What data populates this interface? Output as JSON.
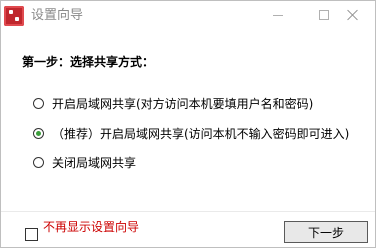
{
  "window": {
    "title": "设置向导",
    "icon": "app-logo-icon"
  },
  "main": {
    "heading": "第一步：选择共享方式：",
    "options": [
      {
        "label": "开启局域网共享(对方访问本机要填用户名和密码)",
        "checked": false
      },
      {
        "label": "（推荐）开启局域网共享(访问本机不输入密码即可进入)",
        "checked": true
      },
      {
        "label": "关闭局域网共享",
        "checked": false
      }
    ]
  },
  "footer": {
    "checkbox_label": "不再显示设置向导",
    "checkbox_checked": false,
    "next_label": "下一步",
    "checkbox_color": "#cc0000"
  },
  "colors": {
    "radio_checked": "#3c9e3c",
    "title_text": "#8a8a8a"
  }
}
